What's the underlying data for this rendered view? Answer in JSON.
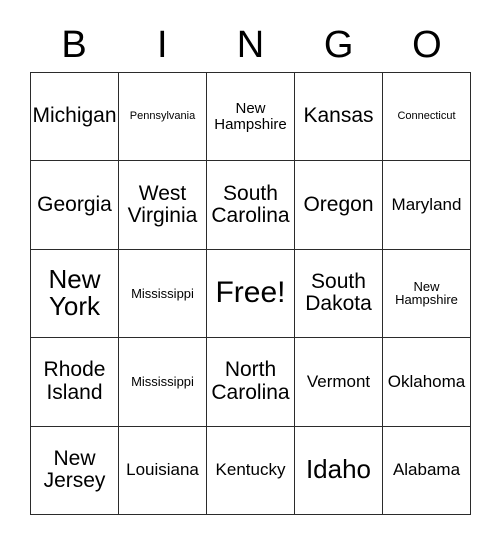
{
  "card": {
    "title_letters": [
      "B",
      "I",
      "N",
      "G",
      "O"
    ],
    "free_space_label": "Free!",
    "colors": {
      "background": "#ffffff",
      "border": "#2b2b2b",
      "text": "#000000"
    },
    "rows": [
      [
        {
          "label": "Michigan",
          "size": "md"
        },
        {
          "label": "Pennsylvania",
          "size": "tiny"
        },
        {
          "label": "New\nHampshire",
          "size": "xs"
        },
        {
          "label": "Kansas",
          "size": "md"
        },
        {
          "label": "Connecticut",
          "size": "tiny"
        }
      ],
      [
        {
          "label": "Georgia",
          "size": "md"
        },
        {
          "label": "West\nVirginia",
          "size": "md"
        },
        {
          "label": "South\nCarolina",
          "size": "md"
        },
        {
          "label": "Oregon",
          "size": "md"
        },
        {
          "label": "Maryland",
          "size": "sm"
        }
      ],
      [
        {
          "label": "New\nYork",
          "size": "lg"
        },
        {
          "label": "Mississippi",
          "size": "xxs"
        },
        {
          "label": "Free!",
          "size": "xl"
        },
        {
          "label": "South\nDakota",
          "size": "md"
        },
        {
          "label": "New\nHampshire",
          "size": "xxs"
        }
      ],
      [
        {
          "label": "Rhode\nIsland",
          "size": "md"
        },
        {
          "label": "Mississippi",
          "size": "xxs"
        },
        {
          "label": "North\nCarolina",
          "size": "md"
        },
        {
          "label": "Vermont",
          "size": "sm"
        },
        {
          "label": "Oklahoma",
          "size": "sm"
        }
      ],
      [
        {
          "label": "New\nJersey",
          "size": "md"
        },
        {
          "label": "Louisiana",
          "size": "sm"
        },
        {
          "label": "Kentucky",
          "size": "sm"
        },
        {
          "label": "Idaho",
          "size": "lg"
        },
        {
          "label": "Alabama",
          "size": "sm"
        }
      ]
    ]
  }
}
